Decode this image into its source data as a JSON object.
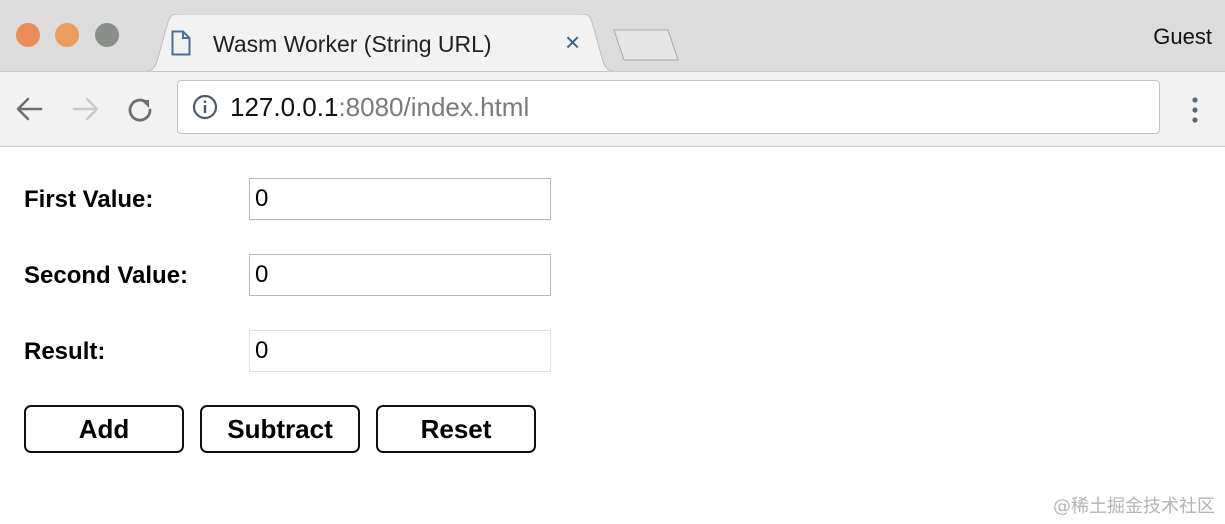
{
  "browser": {
    "tab_title": "Wasm Worker (String URL)",
    "tab_close": "×",
    "profile": "Guest",
    "url_host": "127.0.0.1",
    "url_rest": ":8080/index.html"
  },
  "form": {
    "first_label": "First Value:",
    "first_value": "0",
    "second_label": "Second Value:",
    "second_value": "0",
    "result_label": "Result:",
    "result_value": "0"
  },
  "buttons": {
    "add": "Add",
    "subtract": "Subtract",
    "reset": "Reset"
  },
  "watermark": "@稀土掘金技术社区",
  "colors": {
    "close": "#ec8c5b",
    "minimize": "#eb9d5b",
    "maximize": "#8a8f8a",
    "chrome_bg": "#dcdcdc",
    "toolbar_bg": "#f2f2f2"
  }
}
